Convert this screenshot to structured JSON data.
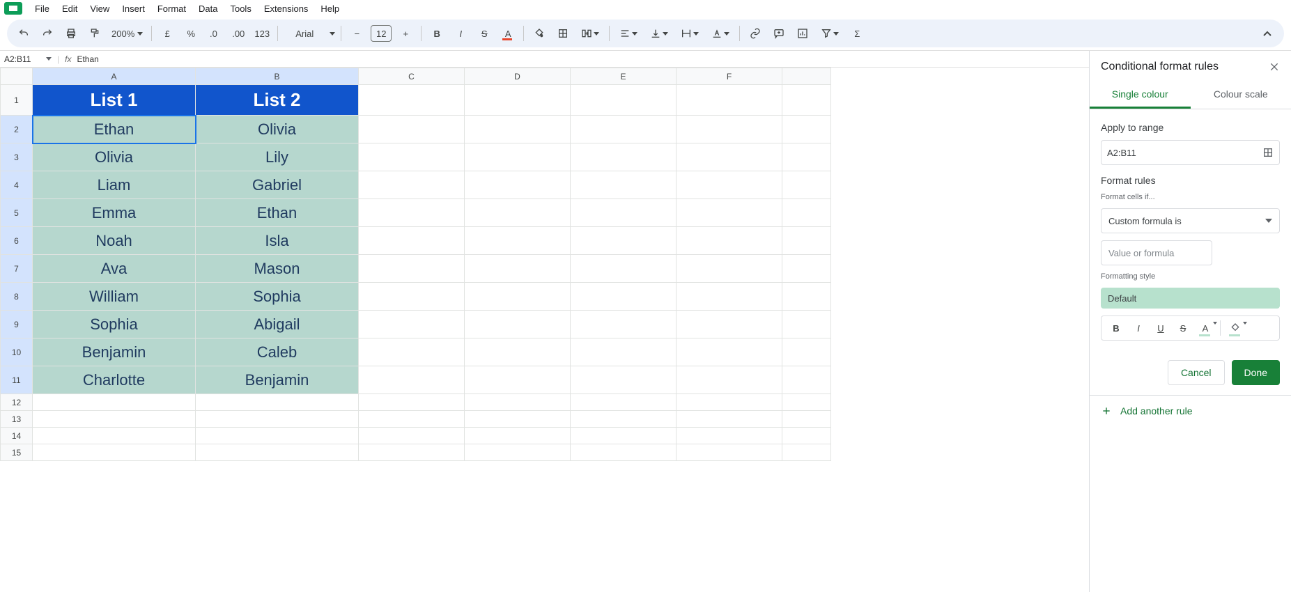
{
  "menu": {
    "items": [
      "File",
      "Edit",
      "View",
      "Insert",
      "Format",
      "Data",
      "Tools",
      "Extensions",
      "Help"
    ]
  },
  "toolbar": {
    "zoom": "200%",
    "font_name": "Arial",
    "font_size": "12"
  },
  "namebox": {
    "ref": "A2:B11",
    "fx_label": "fx",
    "formula": "Ethan"
  },
  "columns": [
    "A",
    "B",
    "C",
    "D",
    "E",
    "F"
  ],
  "rows": [
    "1",
    "2",
    "3",
    "4",
    "5",
    "6",
    "7",
    "8",
    "9",
    "10",
    "11",
    "12",
    "13",
    "14",
    "15"
  ],
  "headers": {
    "A": "List 1",
    "B": "List 2"
  },
  "data": {
    "A": [
      "Ethan",
      "Olivia",
      "Liam",
      "Emma",
      "Noah",
      "Ava",
      "William",
      "Sophia",
      "Benjamin",
      "Charlotte"
    ],
    "B": [
      "Olivia",
      "Lily",
      "Gabriel",
      "Ethan",
      "Isla",
      "Mason",
      "Sophia",
      "Abigail",
      "Caleb",
      "Benjamin"
    ]
  },
  "sidebar": {
    "title": "Conditional format rules",
    "tab_single": "Single colour",
    "tab_scale": "Colour scale",
    "apply_to_range": "Apply to range",
    "range_value": "A2:B11",
    "format_rules": "Format rules",
    "format_cells_if": "Format cells if...",
    "condition": "Custom formula is",
    "formula_placeholder": "Value or formula",
    "formatting_style": "Formatting style",
    "default_label": "Default",
    "cancel": "Cancel",
    "done": "Done",
    "add_rule": "Add another rule"
  }
}
